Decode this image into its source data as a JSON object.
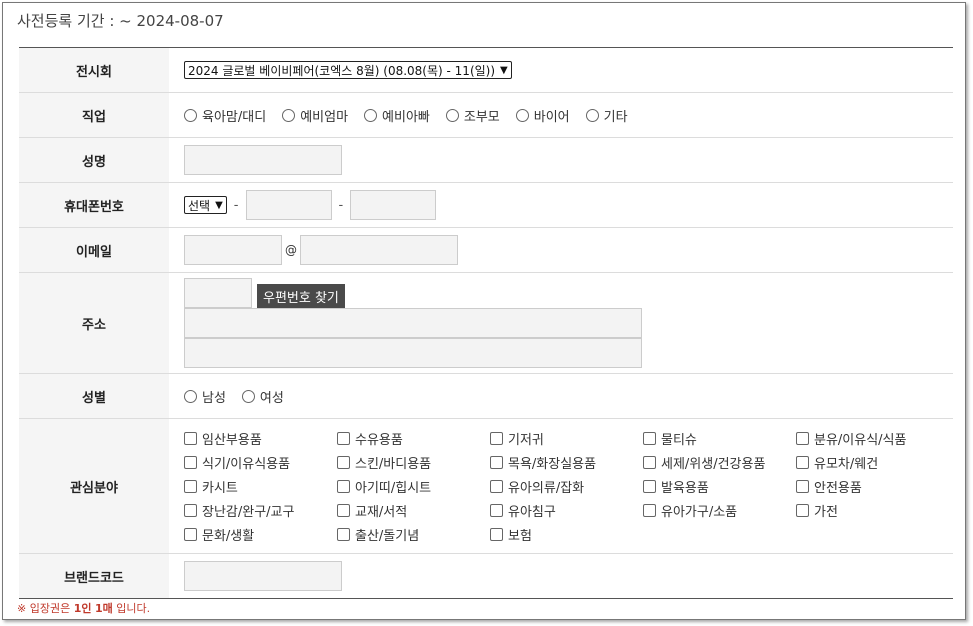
{
  "header": {
    "period_label": "사전등록 기간 : ~ 2024-08-07"
  },
  "form": {
    "exhibition": {
      "label": "전시회",
      "selected": "2024 글로벌 베이비페어(코엑스 8월) (08.08(목) - 11(일))"
    },
    "job": {
      "label": "직업",
      "options": [
        "육아맘/대디",
        "예비엄마",
        "예비아빠",
        "조부모",
        "바이어",
        "기타"
      ]
    },
    "name": {
      "label": "성명",
      "value": ""
    },
    "phone": {
      "label": "휴대폰번호",
      "prefix_selected": "선택",
      "separator": "-"
    },
    "email": {
      "label": "이메일",
      "at": "@"
    },
    "address": {
      "label": "주소",
      "zip_button": "우편번호 찾기"
    },
    "gender": {
      "label": "성별",
      "options": [
        "남성",
        "여성"
      ]
    },
    "interests": {
      "label": "관심분야",
      "options": [
        "임산부용품",
        "수유용품",
        "기저귀",
        "물티슈",
        "분유/이유식/식품",
        "식기/이유식용품",
        "스킨/바디용품",
        "목욕/화장실용품",
        "세제/위생/건강용품",
        "유모차/웨건",
        "카시트",
        "아기띠/힙시트",
        "유아의류/잡화",
        "발육용품",
        "안전용품",
        "장난감/완구/교구",
        "교재/서적",
        "유아침구",
        "유아가구/소품",
        "가전",
        "문화/생활",
        "출산/돌기념",
        "보험"
      ]
    },
    "brand_code": {
      "label": "브랜드코드"
    }
  },
  "notice": {
    "prefix": "※ 입장권은 ",
    "emph1": "1인",
    "mid": " ",
    "emph2": "1매",
    "suffix": " 입니다."
  }
}
